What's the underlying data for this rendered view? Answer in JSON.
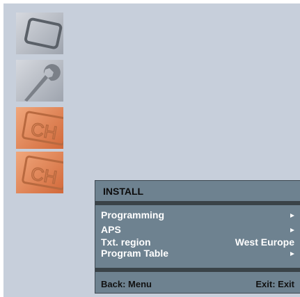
{
  "sidebar": {
    "icons": [
      {
        "name": "picture-icon"
      },
      {
        "name": "setup-icon"
      },
      {
        "name": "channel-icon"
      },
      {
        "name": "install-icon"
      }
    ]
  },
  "menu": {
    "title": "INSTALL",
    "items": [
      {
        "label": "Programming",
        "value": "",
        "arrow": true
      },
      {
        "label": "APS",
        "value": "",
        "arrow": true
      },
      {
        "label": "Txt. region",
        "value": "West Europe",
        "arrow": false
      },
      {
        "label": "Program Table",
        "value": "",
        "arrow": true
      }
    ],
    "footer": {
      "back_label": "Back: Menu",
      "exit_label": "Exit: Exit"
    }
  }
}
